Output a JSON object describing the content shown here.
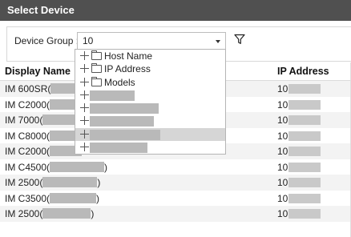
{
  "title": "Select Device",
  "toolbar": {
    "group_label": "Device Group :",
    "group_value": "10"
  },
  "table": {
    "col_name": "Display Name",
    "col_ip": "IP Address",
    "rows": [
      {
        "name": "IM 600SR(",
        "ip": "10."
      },
      {
        "name": "IM C2000(",
        "ip": "10."
      },
      {
        "name": "IM 7000(",
        "ip": "10."
      },
      {
        "name": "IM C8000(",
        "ip": "10."
      },
      {
        "name": "IM C2000(",
        "ip": "10."
      },
      {
        "name": "IM C4500(",
        "close": ")",
        "ip": "10."
      },
      {
        "name": "IM 2500(",
        "close": ")",
        "ip": "10."
      },
      {
        "name": "IM C3500(",
        "close": ")",
        "ip": "10."
      },
      {
        "name": "IM 2500(",
        "close": ")",
        "ip": "10."
      }
    ]
  },
  "dropdown": {
    "items": [
      {
        "label": "Host Name",
        "type": "folder"
      },
      {
        "label": "IP Address",
        "type": "folder"
      },
      {
        "label": "Models",
        "type": "folder"
      },
      {
        "label": "",
        "type": "redacted"
      },
      {
        "label": "",
        "type": "redacted"
      },
      {
        "label": "",
        "type": "redacted"
      },
      {
        "label": "",
        "type": "redacted",
        "selected": true
      },
      {
        "label": "",
        "type": "redacted"
      }
    ]
  }
}
